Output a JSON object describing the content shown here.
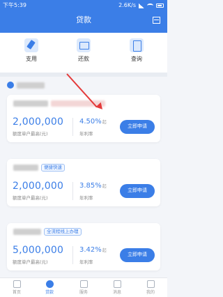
{
  "status_bar": {
    "time": "下午5:39",
    "network_speed": "2.6K/s",
    "signal_icon": "signal-icon",
    "wifi_icon": "wifi-icon",
    "battery_icon": "battery-icon"
  },
  "header": {
    "title": "贷款",
    "scan_icon": "scan-icon"
  },
  "quick_actions": [
    {
      "label": "支用",
      "icon": "loan-use-icon"
    },
    {
      "label": "还款",
      "icon": "card-repay-icon"
    },
    {
      "label": "查询",
      "icon": "document-query-icon"
    }
  ],
  "colors": {
    "brand": "#3b7ee7",
    "annotation": "#e43a3a"
  },
  "products": [
    {
      "tag": "",
      "amount": "2,000,000",
      "amount_label": "额度单户最高(元)",
      "rate": "4.50%",
      "rate_suffix": "起",
      "rate_label": "年利率",
      "button": "立即申请"
    },
    {
      "tag": "便捷快速",
      "amount": "2,000,000",
      "amount_label": "额度单户最高(元)",
      "rate": "3.85%",
      "rate_suffix": "起",
      "rate_label": "年利率",
      "button": "立即申请"
    },
    {
      "tag": "全流程线上办理",
      "amount": "5,000,000",
      "amount_label": "额度单户最高(元)",
      "rate": "3.42%",
      "rate_suffix": "起",
      "rate_label": "年利率",
      "button": "立即申请"
    }
  ],
  "tabbar": [
    {
      "label": "首页",
      "icon": "home-icon",
      "active": false
    },
    {
      "label": "贷款",
      "icon": "loan-icon",
      "active": true
    },
    {
      "label": "服务",
      "icon": "service-icon",
      "active": false
    },
    {
      "label": "消息",
      "icon": "message-icon",
      "active": false
    },
    {
      "label": "我的",
      "icon": "profile-icon",
      "active": false
    }
  ]
}
